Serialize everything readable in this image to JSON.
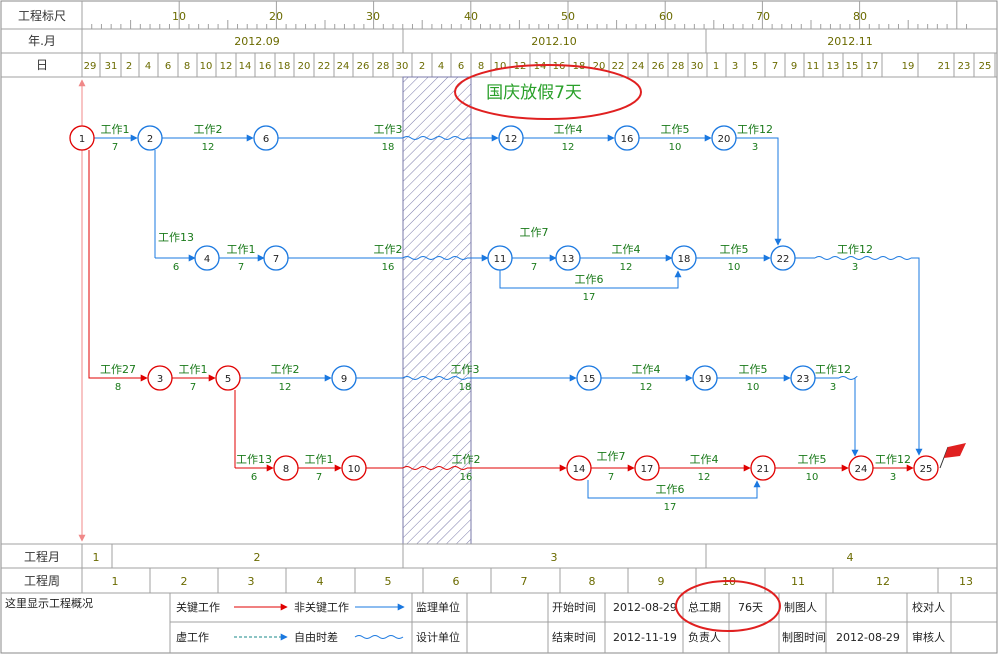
{
  "header": {
    "row_labels": {
      "scale": "工程标尺",
      "yearmonth": "年.月",
      "day": "日"
    },
    "scale_ticks": [
      "10",
      "20",
      "30",
      "40",
      "50",
      "60",
      "70",
      "80"
    ],
    "months": [
      "2012.09",
      "2012.10",
      "2012.11"
    ],
    "days": [
      "29",
      "31",
      "2",
      "4",
      "6",
      "8",
      "10",
      "12",
      "14",
      "16",
      "18",
      "20",
      "22",
      "24",
      "26",
      "28",
      "30",
      "2",
      "4",
      "6",
      "8",
      "10",
      "12",
      "14",
      "16",
      "18",
      "20",
      "22",
      "24",
      "26",
      "28",
      "30",
      "1",
      "3",
      "5",
      "7",
      "9",
      "11",
      "13",
      "15",
      "17",
      "19",
      "21",
      "23",
      "25"
    ]
  },
  "annotation": {
    "holiday_note": "国庆放假7天"
  },
  "nodes": [
    {
      "id": "1",
      "color": "red"
    },
    {
      "id": "2",
      "color": "blue"
    },
    {
      "id": "6",
      "color": "blue"
    },
    {
      "id": "12",
      "color": "blue"
    },
    {
      "id": "16",
      "color": "blue"
    },
    {
      "id": "20",
      "color": "blue"
    },
    {
      "id": "4",
      "color": "blue"
    },
    {
      "id": "7",
      "color": "blue"
    },
    {
      "id": "11",
      "color": "blue"
    },
    {
      "id": "13",
      "color": "blue"
    },
    {
      "id": "18",
      "color": "blue"
    },
    {
      "id": "22",
      "color": "blue"
    },
    {
      "id": "3",
      "color": "red"
    },
    {
      "id": "5",
      "color": "red"
    },
    {
      "id": "9",
      "color": "blue"
    },
    {
      "id": "15",
      "color": "blue"
    },
    {
      "id": "19",
      "color": "blue"
    },
    {
      "id": "23",
      "color": "blue"
    },
    {
      "id": "8",
      "color": "red"
    },
    {
      "id": "10",
      "color": "red"
    },
    {
      "id": "14",
      "color": "red"
    },
    {
      "id": "17",
      "color": "red"
    },
    {
      "id": "21",
      "color": "red"
    },
    {
      "id": "24",
      "color": "red"
    },
    {
      "id": "25",
      "color": "red"
    }
  ],
  "activities": [
    {
      "name": "工作1",
      "duration": "7"
    },
    {
      "name": "工作2",
      "duration": "12"
    },
    {
      "name": "工作3",
      "duration": "18"
    },
    {
      "name": "工作4",
      "duration": "12"
    },
    {
      "name": "工作5",
      "duration": "10"
    },
    {
      "name": "工作12",
      "duration": "3"
    },
    {
      "name": "工作13",
      "duration": "6"
    },
    {
      "name": "工作1",
      "duration": "7"
    },
    {
      "name": "工作2",
      "duration": "16"
    },
    {
      "name": "工作7",
      "duration": "7"
    },
    {
      "name": "工作4",
      "duration": "12"
    },
    {
      "name": "工作6",
      "duration": "17"
    },
    {
      "name": "工作5",
      "duration": "10"
    },
    {
      "name": "工作12",
      "duration": "3"
    },
    {
      "name": "工作27",
      "duration": "8"
    },
    {
      "name": "工作1",
      "duration": "7"
    },
    {
      "name": "工作2",
      "duration": "12"
    },
    {
      "name": "工作3",
      "duration": "18"
    },
    {
      "name": "工作4",
      "duration": "12"
    },
    {
      "name": "工作5",
      "duration": "10"
    },
    {
      "name": "工作12",
      "duration": "3"
    },
    {
      "name": "工作13",
      "duration": "6"
    },
    {
      "name": "工作1",
      "duration": "7"
    },
    {
      "name": "工作2",
      "duration": "16"
    },
    {
      "name": "工作7",
      "duration": "7"
    },
    {
      "name": "工作4",
      "duration": "12"
    },
    {
      "name": "工作6",
      "duration": "17"
    },
    {
      "name": "工作5",
      "duration": "10"
    },
    {
      "name": "工作12",
      "duration": "3"
    }
  ],
  "footer": {
    "month_row": {
      "label": "工程月",
      "values": [
        "1",
        "2",
        "3",
        "4"
      ]
    },
    "week_row": {
      "label": "工程周",
      "values": [
        "1",
        "2",
        "3",
        "4",
        "5",
        "6",
        "7",
        "8",
        "9",
        "10",
        "11",
        "12",
        "13"
      ]
    },
    "summary_label": "这里显示工程概况",
    "legend": {
      "critical": "关键工作",
      "noncritical": "非关键工作",
      "dummy": "虚工作",
      "float": "自由时差"
    },
    "unit": {
      "supervisor": "监理单位",
      "design": "设计单位"
    },
    "dates": {
      "start_label": "开始时间",
      "start_value": "2012-08-29",
      "end_label": "结束时间",
      "end_value": "2012-11-19"
    },
    "duration": {
      "label": "总工期",
      "value": "76天"
    },
    "people": {
      "drawer": "制图人",
      "owner": "负责人",
      "draw_time": "制图时间",
      "draw_time_value": "2012-08-29",
      "checker": "校对人",
      "reviewer": "审核人"
    }
  },
  "colors": {
    "critical": "#e00000",
    "noncritical": "#1a78e0",
    "label": "#1a7a1a",
    "header_text": "#6b6b00",
    "grid": "#a0a0a0"
  }
}
